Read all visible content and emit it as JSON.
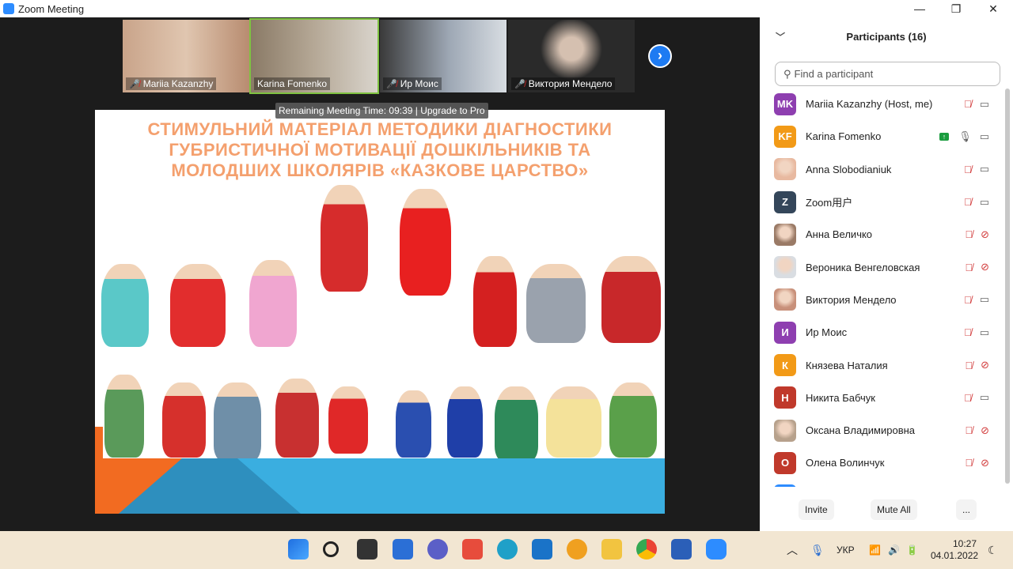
{
  "window": {
    "title": "Zoom Meeting",
    "minimize": "—",
    "restore": "❐",
    "close": "✕"
  },
  "videos": [
    {
      "name": "Mariia Kazanzhy",
      "muted": true
    },
    {
      "name": "Karina Fomenko",
      "muted": false
    },
    {
      "name": "Ир Моис",
      "muted": true
    },
    {
      "name": "Виктория Менделo",
      "muted": true
    }
  ],
  "next_label": "›",
  "remaining": "Remaining Meeting Time: 09:39 | Upgrade to Pro",
  "slide": {
    "title_lines": [
      "СТИМУЛЬНИЙ МАТЕРІАЛ МЕТОДИКИ ДІАГНОСТИКИ",
      "ГУБРИСТИЧНОЇ МОТИВАЦІЇ ДОШКІЛЬНИКІВ ТА",
      "МОЛОДШИХ ШКОЛЯРІВ «КАЗКОВЕ ЦАРСТВО»"
    ]
  },
  "panel": {
    "title": "Participants (16)",
    "search_placeholder": "Find a participant",
    "participants": [
      {
        "initials": "MK",
        "name": "Mariia Kazanzhy (Host, me)",
        "color": "#8e3fb0",
        "mic": "off",
        "video": "on"
      },
      {
        "initials": "KF",
        "name": "Karina Fomenko",
        "color": "#f29a17",
        "mic": "on",
        "video": "on",
        "sharing": true
      },
      {
        "initials": "",
        "name": "Anna Slobodianiuk",
        "color": "#e8b9a0",
        "mic": "off",
        "video": "on"
      },
      {
        "initials": "Z",
        "name": "Zoom用户",
        "color": "#34465a",
        "mic": "off",
        "video": "on"
      },
      {
        "initials": "",
        "name": "Анна Величко",
        "color": "#9a7a66",
        "mic": "off",
        "video": "off"
      },
      {
        "initials": "",
        "name": "Вероника Венгеловская",
        "color": "#d9dde2",
        "mic": "off",
        "video": "off"
      },
      {
        "initials": "",
        "name": "Виктория Менделo",
        "color": "#c8907a",
        "mic": "off",
        "video": "on"
      },
      {
        "initials": "И",
        "name": "Ир Моис",
        "color": "#8e3fb0",
        "mic": "off",
        "video": "on"
      },
      {
        "initials": "К",
        "name": "Князева Наталия",
        "color": "#f29a17",
        "mic": "off",
        "video": "off"
      },
      {
        "initials": "Н",
        "name": "Никита Бабчук",
        "color": "#c0392b",
        "mic": "off",
        "video": "on"
      },
      {
        "initials": "",
        "name": "Оксана Владимировна",
        "color": "#b7a18c",
        "mic": "off",
        "video": "off"
      },
      {
        "initials": "О",
        "name": "Олена Волинчук",
        "color": "#c0392b",
        "mic": "off",
        "video": "off"
      }
    ],
    "invite": "Invite",
    "mute_all": "Mute All",
    "more": "..."
  },
  "tray": {
    "lang": "УКР",
    "time": "10:27",
    "date": "04.01.2022"
  }
}
